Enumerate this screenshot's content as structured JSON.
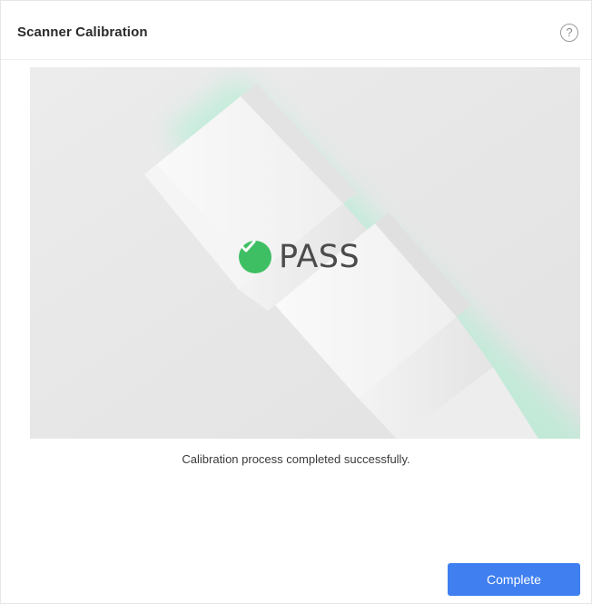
{
  "dialog": {
    "title": "Scanner Calibration",
    "help_symbol": "?",
    "help_icon": "question-circle-icon"
  },
  "preview": {
    "status_icon": "check-circle-icon",
    "status_text": "PASS",
    "status_color": "#3fbf63",
    "illustration": "calibration-tube"
  },
  "message": "Calibration process completed successfully.",
  "footer": {
    "complete_label": "Complete",
    "button_color": "#3f7ff0"
  }
}
